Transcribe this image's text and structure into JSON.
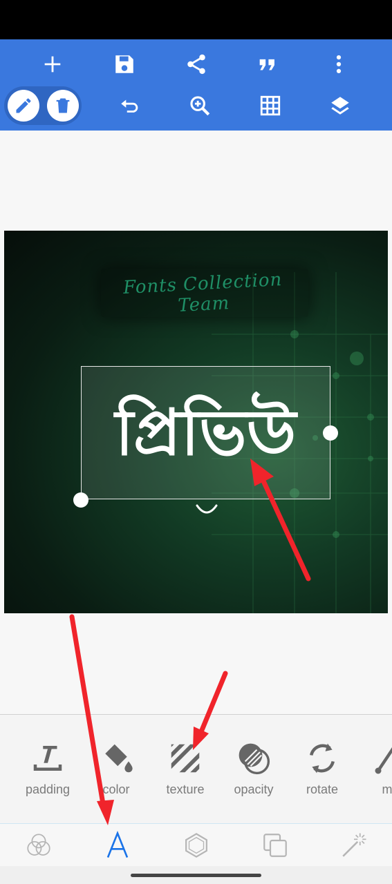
{
  "toolbar": {
    "row1": [
      {
        "name": "add-icon"
      },
      {
        "name": "save-icon"
      },
      {
        "name": "share-icon"
      },
      {
        "name": "quote-icon"
      },
      {
        "name": "more-vertical-icon"
      }
    ],
    "row2": [
      {
        "name": "undo-icon"
      },
      {
        "name": "zoom-in-icon"
      },
      {
        "name": "grid-icon"
      },
      {
        "name": "layers-icon"
      }
    ],
    "mode_buttons": [
      {
        "name": "edit-pencil-icon",
        "selected": true
      },
      {
        "name": "delete-trash-icon",
        "selected": false
      }
    ],
    "accent_color": "#3a78de"
  },
  "canvas": {
    "watermark": "Fonts Collection Team",
    "text_layer": "প্রিভিউ"
  },
  "tools": [
    {
      "label": "padding",
      "icon": "padding-icon"
    },
    {
      "label": "color",
      "icon": "paint-bucket-icon"
    },
    {
      "label": "texture",
      "icon": "texture-icon"
    },
    {
      "label": "opacity",
      "icon": "opacity-icon"
    },
    {
      "label": "rotate",
      "icon": "rotate-icon"
    },
    {
      "label": "ma",
      "icon": "magic-icon"
    }
  ],
  "tabs": [
    {
      "name": "tab-blend",
      "icon": "blend-circles-icon",
      "active": false
    },
    {
      "name": "tab-text",
      "icon": "text-a-icon",
      "active": true
    },
    {
      "name": "tab-shape",
      "icon": "hexagon-icon",
      "active": false
    },
    {
      "name": "tab-layer",
      "icon": "overlap-squares-icon",
      "active": false
    },
    {
      "name": "tab-effects",
      "icon": "magic-wand-icon",
      "active": false
    }
  ],
  "active_tab_color": "#1a73e8"
}
